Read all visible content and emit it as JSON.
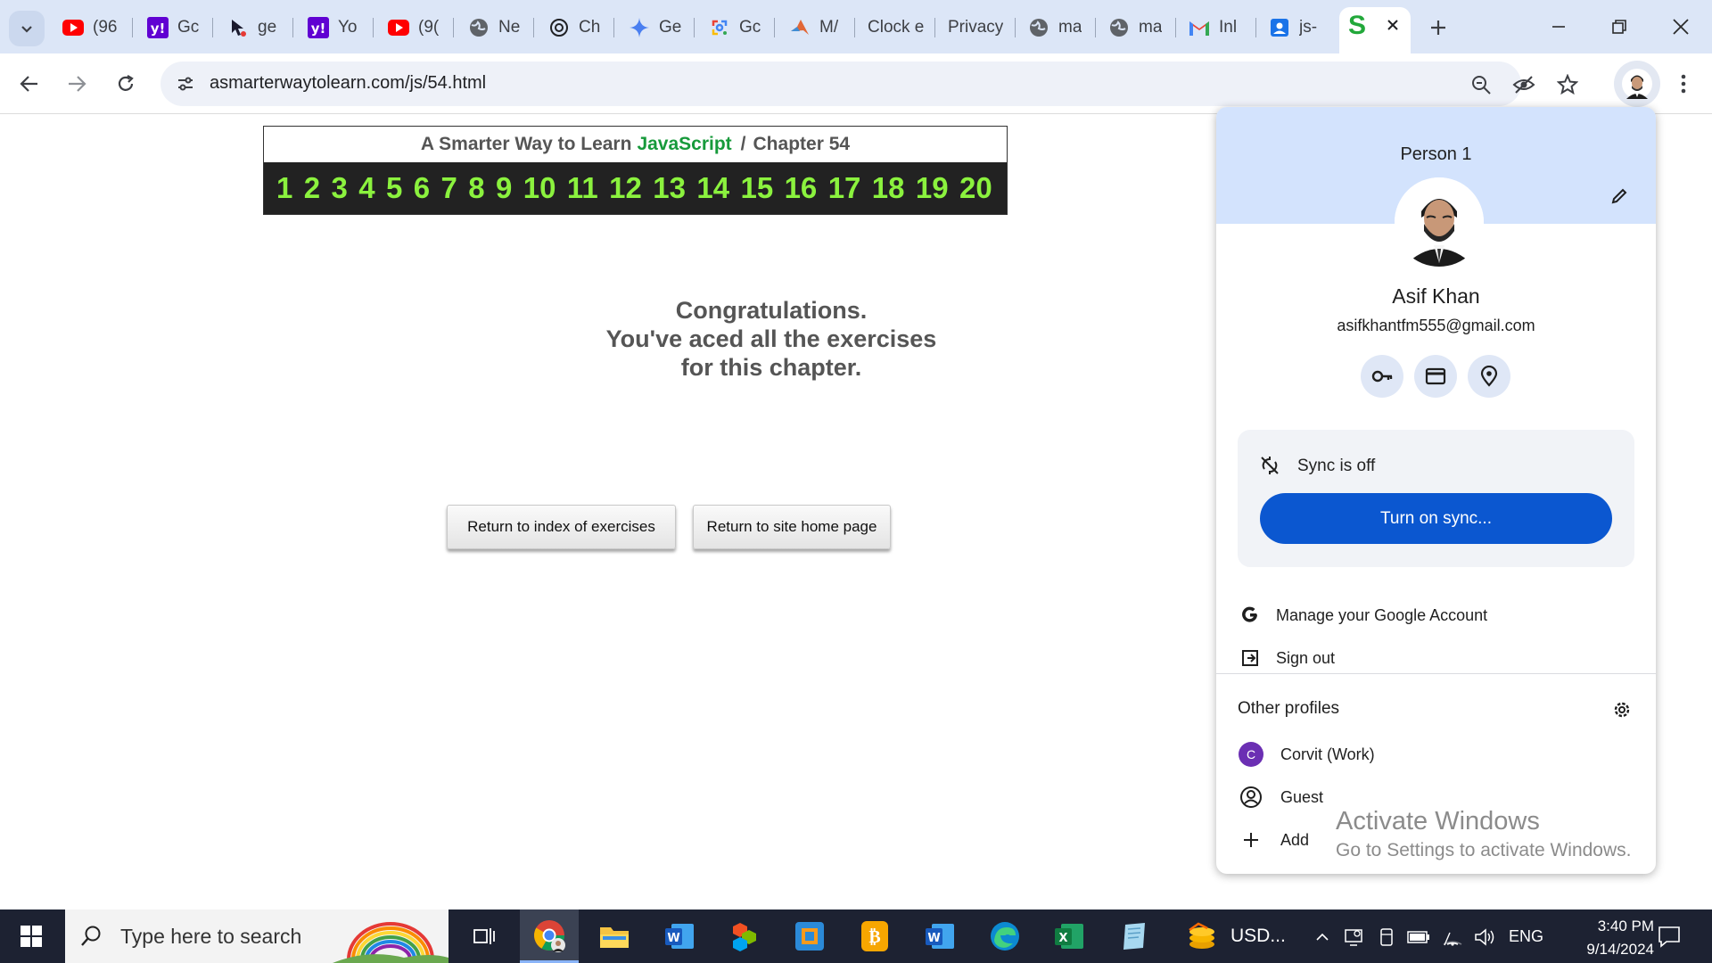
{
  "browser": {
    "tabs": [
      {
        "title": "(96",
        "icon": "youtube-icon"
      },
      {
        "title": "Gc",
        "icon": "yahoo-icon"
      },
      {
        "title": "ge",
        "icon": "cursor-icon"
      },
      {
        "title": "Yo",
        "icon": "yahoo-icon"
      },
      {
        "title": "(9(",
        "icon": "youtube-icon"
      },
      {
        "title": "Ne",
        "icon": "globe-icon"
      },
      {
        "title": "Ch",
        "icon": "openai-icon"
      },
      {
        "title": "Ge",
        "icon": "gemini-icon"
      },
      {
        "title": "Gc",
        "icon": "google-lens-icon"
      },
      {
        "title": "M/",
        "icon": "matlab-icon"
      },
      {
        "title": "Clock e",
        "icon": "none"
      },
      {
        "title": "Privacy",
        "icon": "none"
      },
      {
        "title": "ma",
        "icon": "globe-icon"
      },
      {
        "title": "ma",
        "icon": "globe-icon"
      },
      {
        "title": "Inl",
        "icon": "gmail-icon"
      },
      {
        "title": "js-",
        "icon": "contacts-icon"
      }
    ],
    "active_tab_favicon": "S",
    "url": "asmarterwaytolearn.com/js/54.html",
    "colors": {
      "tabstrip": "#dce6f7",
      "accent": "#0b57d0"
    }
  },
  "page": {
    "header": {
      "prefix": "A Smarter Way to Learn",
      "highlight": "JavaScript",
      "separator": "/",
      "chapter": "Chapter 54"
    },
    "exercise_numbers": [
      "1",
      "2",
      "3",
      "4",
      "5",
      "6",
      "7",
      "8",
      "9",
      "10",
      "11",
      "12",
      "13",
      "14",
      "15",
      "16",
      "17",
      "18",
      "19",
      "20"
    ],
    "congrats_lines": [
      "Congratulations.",
      "You've aced all the exercises",
      "for this chapter."
    ],
    "buttons": {
      "index": "Return to index of exercises",
      "home": "Return to site home page"
    }
  },
  "profile_menu": {
    "person_label": "Person 1",
    "name": "Asif Khan",
    "email": "asifkhantfm555@gmail.com",
    "quick_icons": [
      "key-icon",
      "credit-card-icon",
      "location-pin-icon"
    ],
    "sync_status": "Sync is off",
    "sync_button": "Turn on sync...",
    "manage_account": "Manage your Google Account",
    "sign_out": "Sign out",
    "other_profiles_label": "Other profiles",
    "profiles": [
      {
        "name": "Corvit (Work)",
        "initial": "C"
      },
      {
        "name": "Guest",
        "initial": ""
      }
    ],
    "add_label": "Add"
  },
  "watermark": {
    "line1": "Activate Windows",
    "line2": "Go to Settings to activate Windows."
  },
  "taskbar": {
    "search_placeholder": "Type here to search",
    "currency_label": "USD...",
    "language": "ENG",
    "time": "3:40 PM",
    "date": "9/14/2024"
  }
}
